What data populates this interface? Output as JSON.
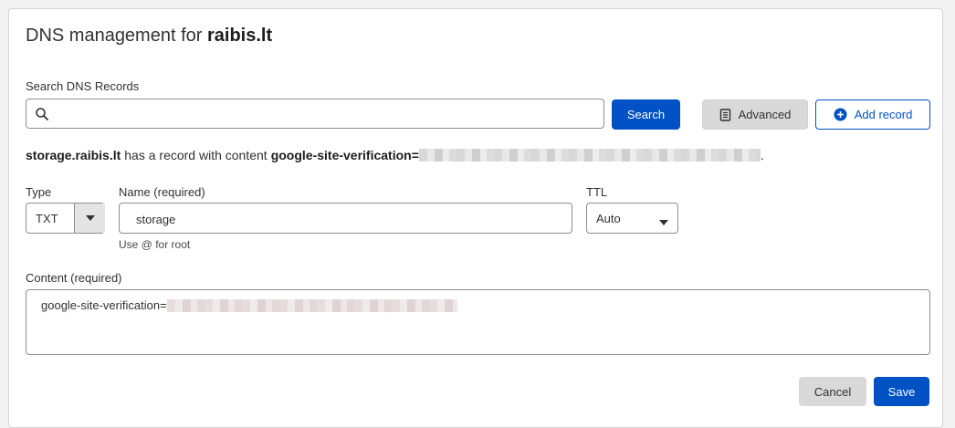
{
  "header": {
    "title_prefix": "DNS management for",
    "domain": "raibis.lt"
  },
  "search": {
    "label": "Search DNS Records",
    "value": "",
    "placeholder": "",
    "button_label": "Search"
  },
  "toolbar": {
    "advanced_label": "Advanced",
    "add_record_label": "Add record"
  },
  "summary": {
    "record_name": "storage.raibis.lt",
    "middle_text": "has a record with content",
    "content_prefix": "google-site-verification=",
    "end": "."
  },
  "form": {
    "type_label": "Type",
    "type_value": "TXT",
    "name_label": "Name (required)",
    "name_value": "storage",
    "name_hint": "Use @ for root",
    "ttl_label": "TTL",
    "ttl_value": "Auto",
    "content_label": "Content (required)",
    "content_prefix": "google-site-verification="
  },
  "actions": {
    "cancel_label": "Cancel",
    "save_label": "Save"
  },
  "colors": {
    "primary": "#0051c3",
    "secondary_button": "#d9d9d9"
  }
}
